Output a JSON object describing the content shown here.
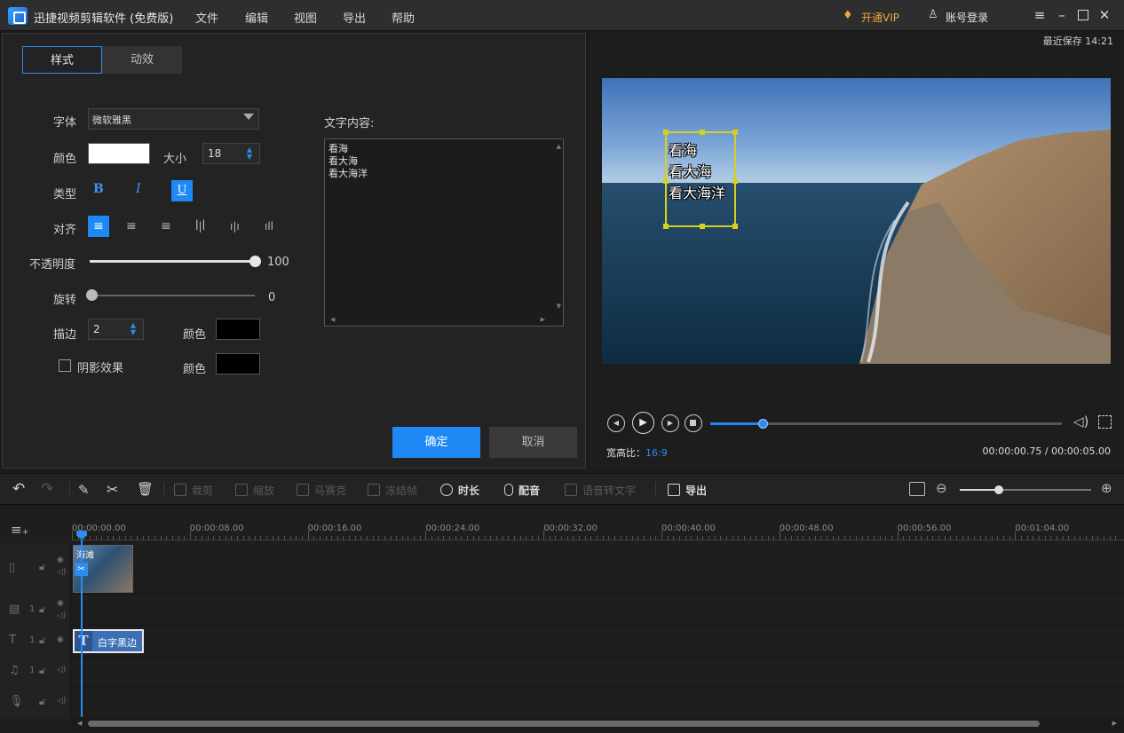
{
  "app": {
    "title": "迅捷视频剪辑软件 (免费版)",
    "menu": [
      "文件",
      "编辑",
      "视图",
      "导出",
      "帮助"
    ],
    "vip_label": "开通VIP",
    "login_label": "账号登录"
  },
  "style_panel": {
    "tabs": [
      "样式",
      "动效"
    ],
    "font_label": "字体",
    "font_value": "微软雅黑",
    "color_label": "颜色",
    "font_color": "#ffffff",
    "size_label": "大小",
    "size_value": "18",
    "type_label": "类型",
    "type_buttons": [
      "B",
      "I",
      "U"
    ],
    "align_label": "对齐",
    "opacity_label": "不透明度",
    "opacity_value": "100",
    "opacity_fraction": 1.0,
    "rotate_label": "旋转",
    "rotate_value": "0",
    "rotate_fraction": 0.0,
    "stroke_label": "描边",
    "stroke_value": "2",
    "stroke_color_label": "颜色",
    "stroke_color": "#000000",
    "shadow_label": "阴影效果",
    "shadow_checked": false,
    "shadow_color_label": "颜色",
    "shadow_color": "#000000",
    "content_label": "文字内容:",
    "content_lines": [
      "看海",
      "看大海",
      "看大海洋"
    ],
    "confirm_label": "确定",
    "cancel_label": "取消"
  },
  "preview": {
    "last_saved": "最近保存 14:21",
    "overlay_lines": [
      "看海",
      "看大海",
      "看大海洋"
    ],
    "aspect_label": "宽高比：",
    "aspect_value": "16:9",
    "time_display": "00:00:00.75 / 00:00:05.00",
    "progress_fraction": 0.15
  },
  "toolbar": {
    "crop": "裁剪",
    "zoom": "缩放",
    "mosaic": "马赛克",
    "freeze": "冻结帧",
    "duration": "时长",
    "dub": "配音",
    "speech_to_text": "语音转文字",
    "export": "导出"
  },
  "timeline": {
    "ruler": [
      "00:00:00.00",
      "00:00:08.00",
      "00:00:16.00",
      "00:00:24.00",
      "00:00:32.00",
      "00:00:40.00",
      "00:00:48.00",
      "00:00:56.00",
      "00:01:04.00"
    ],
    "video_clip_label": "海滩",
    "text_clip_label": "白字黑边",
    "track_numbers": [
      "1",
      "1",
      "1"
    ]
  },
  "colors": {
    "accent": "#1e88f5",
    "panel": "#232323",
    "titlebar": "#2e2e2e"
  }
}
